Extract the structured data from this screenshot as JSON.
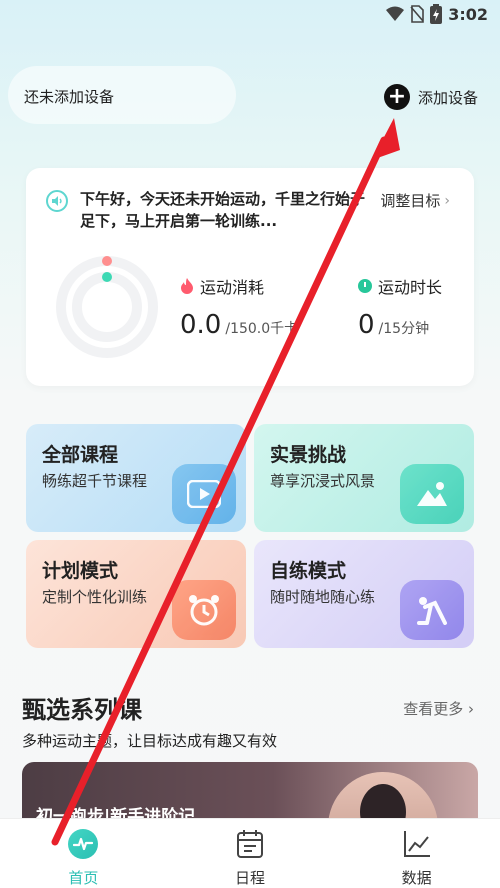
{
  "status_bar": {
    "time": "3:02"
  },
  "header": {
    "no_device_text": "还未添加设备",
    "add_device_label": "添加设备"
  },
  "goal_card": {
    "greeting": "下午好，今天还未开始运动，千里之行始于足下，马上开启第一轮训练...",
    "adjust_goal_label": "调整目标",
    "calories": {
      "label": "运动消耗",
      "value": "0.0",
      "goal": "/150.0千卡",
      "progress": 0
    },
    "duration": {
      "label": "运动时长",
      "value": "0",
      "goal": "/15分钟",
      "progress": 0
    },
    "colors": {
      "calories": "#ff8f8f",
      "duration": "#3dd9b4"
    }
  },
  "tiles": [
    {
      "title": "全部课程",
      "subtitle": "畅练超千节课程",
      "icon": "play-icon"
    },
    {
      "title": "实景挑战",
      "subtitle": "尊享沉浸式风景",
      "icon": "landscape-icon"
    },
    {
      "title": "计划模式",
      "subtitle": "定制个性化训练",
      "icon": "alarm-clock-icon"
    },
    {
      "title": "自练模式",
      "subtitle": "随时随地随心练",
      "icon": "exercise-icon"
    }
  ],
  "series": {
    "title": "甄选系列课",
    "see_more": "查看更多",
    "subtitle": "多种运动主题，让目标达成有趣又有效",
    "banner_text": "初一跑步|新手进阶记"
  },
  "bottom_nav": [
    {
      "label": "首页",
      "icon": "home-pulse-icon",
      "active": true
    },
    {
      "label": "日程",
      "icon": "calendar-icon",
      "active": false
    },
    {
      "label": "数据",
      "icon": "chart-icon",
      "active": false
    }
  ],
  "annotation": {
    "arrow_color": "#e8202a"
  }
}
